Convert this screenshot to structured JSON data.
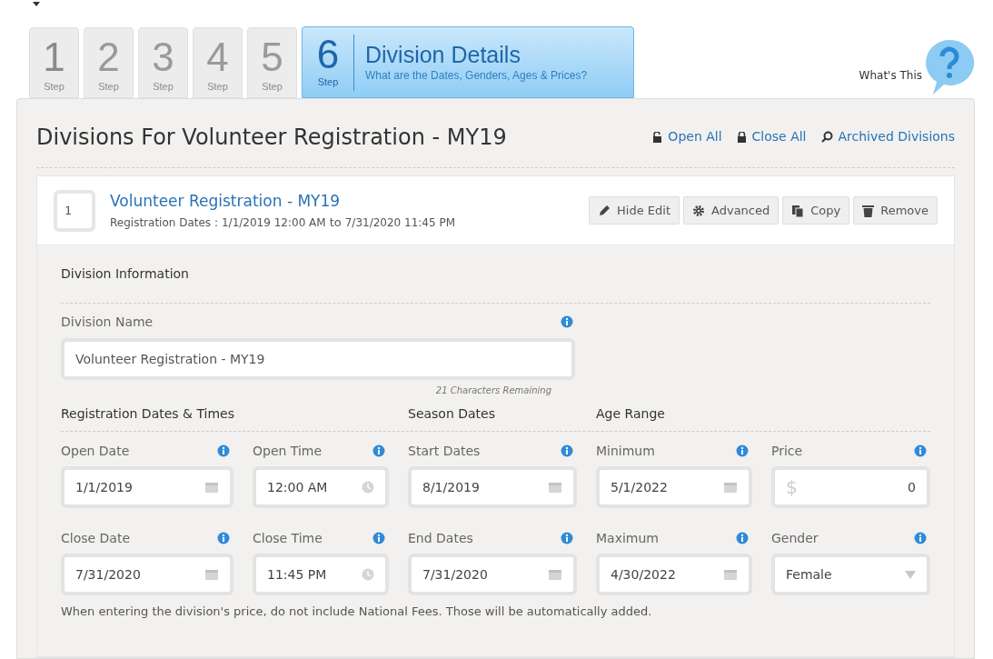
{
  "steps": [
    {
      "number": "1",
      "label": "Step",
      "selected": false
    },
    {
      "number": "2",
      "label": "Step",
      "selected": false
    },
    {
      "number": "3",
      "label": "Step",
      "selected": false
    },
    {
      "number": "4",
      "label": "Step",
      "selected": false
    },
    {
      "number": "5",
      "label": "Step",
      "selected": false
    },
    {
      "number": "6",
      "label": "Step",
      "selected": true,
      "title": "Division Details",
      "subtitle": "What are the Dates, Genders, Ages & Prices?"
    }
  ],
  "help": {
    "label": "What's This"
  },
  "page_title": "Divisions For Volunteer Registration - MY19",
  "header_links": [
    {
      "kind": "open",
      "label": "Open All"
    },
    {
      "kind": "close",
      "label": "Close All"
    },
    {
      "kind": "search",
      "label": "Archived Divisions"
    }
  ],
  "division": {
    "order": "1",
    "name": "Volunteer Registration - MY19",
    "dates_label": "Registration Dates :",
    "dates_from": "1/1/2019 12:00 AM",
    "dates_to_word": "to",
    "dates_to": "7/31/2020 11:45 PM",
    "actions": [
      {
        "kind": "edit",
        "label": "Hide Edit"
      },
      {
        "kind": "gear",
        "label": "Advanced"
      },
      {
        "kind": "copy",
        "label": "Copy"
      },
      {
        "kind": "trash",
        "label": "Remove"
      }
    ]
  },
  "form": {
    "section_title": "Division Information",
    "name_label": "Division Name",
    "name_value": "Volunteer Registration - MY19",
    "name_hint": "21 Characters Remaining",
    "group_titles": [
      "Registration Dates & Times",
      "Season Dates",
      "Age Range"
    ],
    "rows": [
      [
        {
          "label": "Open Date",
          "kind": "date",
          "value": "1/1/2019"
        },
        {
          "label": "Open Time",
          "kind": "time",
          "value": "12:00 AM"
        },
        {
          "label": "Start Dates",
          "kind": "date",
          "value": "8/1/2019"
        },
        {
          "label": "Minimum",
          "kind": "date",
          "value": "5/1/2022"
        },
        {
          "label": "Price",
          "kind": "price",
          "prefix": "$",
          "value": "0"
        }
      ],
      [
        {
          "label": "Close Date",
          "kind": "date",
          "value": "7/31/2020"
        },
        {
          "label": "Close Time",
          "kind": "time",
          "value": "11:45 PM"
        },
        {
          "label": "End Dates",
          "kind": "date",
          "value": "7/31/2020"
        },
        {
          "label": "Maximum",
          "kind": "date",
          "value": "4/30/2022"
        },
        {
          "label": "Gender",
          "kind": "select",
          "value": "Female"
        }
      ]
    ],
    "note": "When entering the division's price, do not include National Fees. Those will be automatically added."
  }
}
